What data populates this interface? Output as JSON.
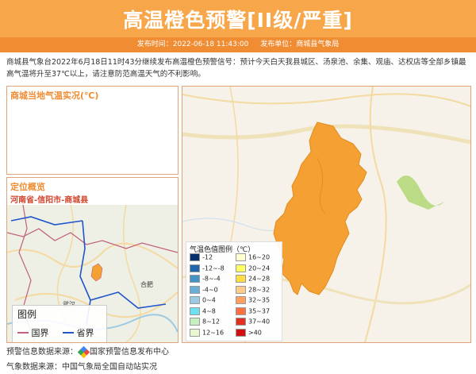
{
  "header": {
    "title": "高温橙色预警[II级/严重]",
    "publish_time": "发布时间：2022-06-18 11:43:00",
    "publish_unit": "发布单位：商城县气象局"
  },
  "description": "商城县气象台2022年6月18日11时43分继续发布高温橙色预警信号：预计今天白天我县城区、汤泉池、余集、观庙、达权店等全部乡镇最高气温将升至37℃以上，请注意防范高温天气的不利影响。",
  "temp_panel": {
    "title": "商城当地气温实况(℃)"
  },
  "location_panel": {
    "title": "定位概览",
    "subtitle": "河南省-信阳市-商城县",
    "map_labels": {
      "hefei": "合肥",
      "wuhan": "武汉"
    },
    "legend_title": "图例",
    "legend_national": "国界",
    "legend_province": "省界",
    "colors": {
      "national": "#c0607a",
      "province": "#2255cc"
    }
  },
  "legend": {
    "title": "气温色值图例（℃）",
    "left": [
      {
        "label": "-12",
        "color": "#08306b"
      },
      {
        "label": "-12~-8",
        "color": "#2166ac"
      },
      {
        "label": "-8~-4",
        "color": "#4393c3"
      },
      {
        "label": "-4~0",
        "color": "#6baed6"
      },
      {
        "label": "0~4",
        "color": "#9ecae1"
      },
      {
        "label": "4~8",
        "color": "#6ee0f0"
      },
      {
        "label": "8~12",
        "color": "#c6f0c0"
      },
      {
        "label": "12~16",
        "color": "#e8f7d0"
      }
    ],
    "right": [
      {
        "label": "16~20",
        "color": "#ffffd0"
      },
      {
        "label": "20~24",
        "color": "#ffff66"
      },
      {
        "label": "24~28",
        "color": "#ffdd44"
      },
      {
        "label": "28~32",
        "color": "#ffcc88"
      },
      {
        "label": "32~35",
        "color": "#ffa060"
      },
      {
        "label": "35~37",
        "color": "#ff7040"
      },
      {
        "label": "37~40",
        "color": "#e03020"
      },
      {
        "label": ">40",
        "color": "#d01010"
      }
    ]
  },
  "footer": {
    "warning_source": "预警信息数据来源：",
    "warning_org": "国家预警信息发布中心",
    "weather_source": "气象数据来源：中国气象局全国自动站实况"
  },
  "colors": {
    "header": "#f7a64a",
    "meta_bar": "#f08c32",
    "region": "#f5a033"
  }
}
